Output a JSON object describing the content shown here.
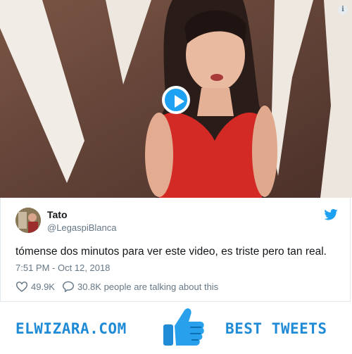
{
  "video": {
    "play_icon": "play-icon",
    "info_icon": "info-icon",
    "info_label": "i"
  },
  "tweet": {
    "author_name": "Tato",
    "author_handle": "@LegaspiBlanca",
    "text": "tómense dos minutos para ver este video, es triste pero tan real.",
    "timestamp": "7:51 PM - Oct 12, 2018",
    "likes": "49.9K",
    "talking": "30.8K people are talking about this",
    "brand_icon": "twitter-bird-icon",
    "accent_color": "#1da1f2"
  },
  "banner": {
    "left_text": "ELWIZARA.COM",
    "right_text": "BEST TWEETS",
    "icon": "thumbs-up-icon",
    "color": "#1f8ad6"
  }
}
